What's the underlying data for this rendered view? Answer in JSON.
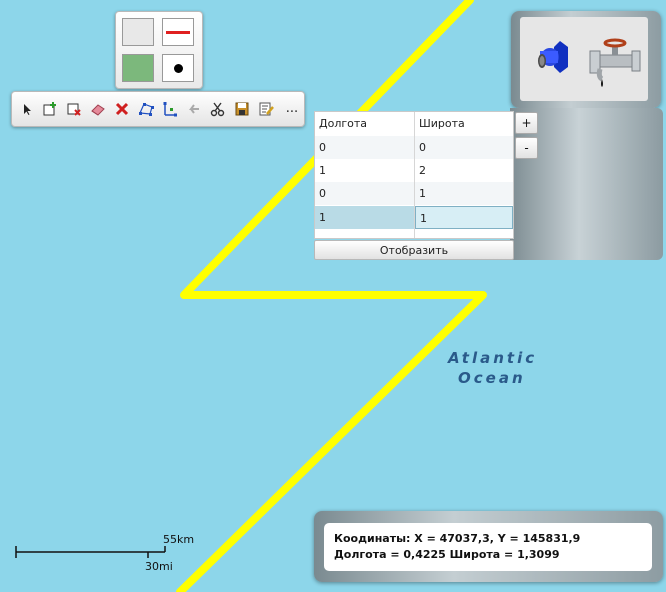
{
  "map": {
    "ocean_label_line1": "Atlantic",
    "ocean_label_line2": "Ocean",
    "background_color": "#8dd6ea",
    "drawn_line_color": "#ffff00",
    "scale": {
      "km_label": "55km",
      "mi_label": "30mi"
    }
  },
  "style_palette": {
    "fill_empty_color": "#e8e8e8",
    "line_color": "#e02020",
    "fill_color": "#7cb87c",
    "point_color": "#000000"
  },
  "toolbar": {
    "tools": [
      "select-arrow-icon",
      "add-shape-icon",
      "delete-shape-icon",
      "eraser-icon",
      "delete-x-icon",
      "edit-vertices-icon",
      "edit-points-icon",
      "undo-arrow-icon",
      "scissors-icon",
      "save-icon",
      "edit-document-icon"
    ],
    "more_label": "..."
  },
  "logo": {
    "icons": [
      "valve-icon",
      "pipe-faucet-icon"
    ]
  },
  "coords_grid": {
    "headers": [
      "Долгота",
      "Широта"
    ],
    "rows": [
      [
        "0",
        "0"
      ],
      [
        "1",
        "2"
      ],
      [
        "0",
        "1"
      ],
      [
        "1",
        "1"
      ]
    ],
    "selected_row": 3,
    "add_label": "+",
    "remove_label": "-",
    "display_label": "Отобразить"
  },
  "readout": {
    "line1": "Коодинаты: X = 47037,3, Y = 145831,9",
    "line2": "Долгота = 0,4225 Широта = 1,3099"
  }
}
